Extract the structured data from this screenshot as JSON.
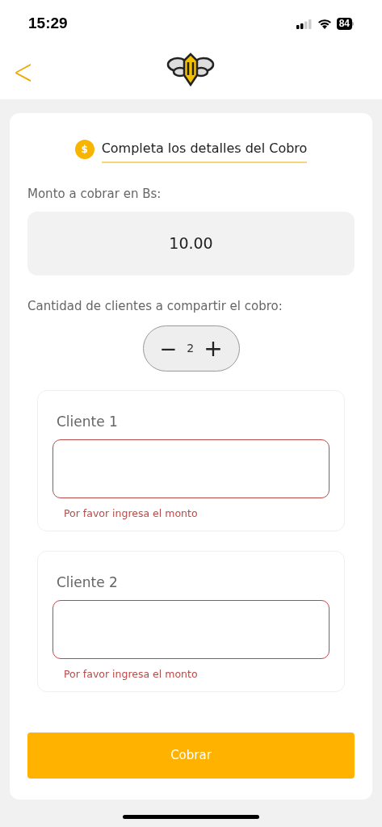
{
  "status_bar": {
    "time": "15:29",
    "battery": "84"
  },
  "header": {
    "back": "<"
  },
  "form": {
    "coin": "$",
    "title": "Completa los detalles del Cobro",
    "amount_label": "Monto a cobrar en Bs:",
    "amount_value": "10.00",
    "count_label": "Cantidad de clientes a compartir el cobro:",
    "stepper": {
      "minus": "−",
      "value": "2",
      "plus": "+"
    },
    "clients": [
      {
        "label": "Cliente 1",
        "error": "Por favor ingresa el monto"
      },
      {
        "label": "Cliente 2",
        "error": "Por favor ingresa el monto"
      }
    ],
    "submit": "Cobrar"
  }
}
